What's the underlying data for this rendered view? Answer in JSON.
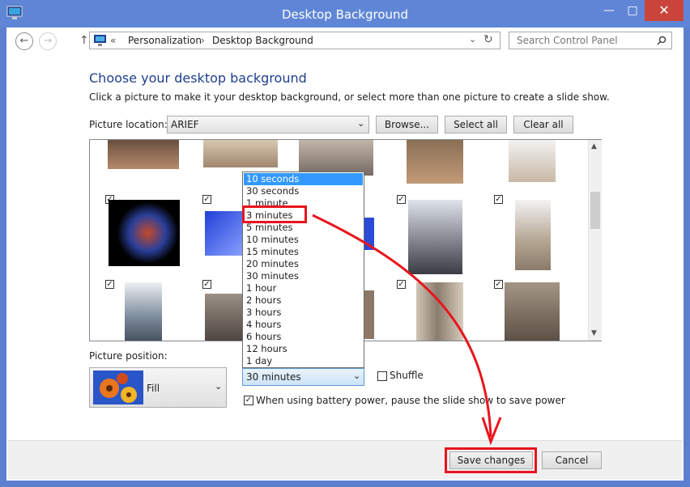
{
  "window": {
    "title": "Desktop Background",
    "minimize_icon": "minimize-icon",
    "maximize_icon": "maximize-icon",
    "close_icon": "close-icon"
  },
  "nav": {
    "back_icon": "back-arrow-icon",
    "forward_icon": "forward-arrow-icon",
    "up_icon": "up-arrow-icon",
    "breadcrumb_sep": "«",
    "breadcrumb": [
      "Personalization",
      "Desktop Background"
    ],
    "search_placeholder": "Search Control Panel"
  },
  "main": {
    "heading": "Choose your desktop background",
    "subtext": "Click a picture to make it your desktop background, or select more than one picture to create a slide show.",
    "picture_location_label": "Picture location:",
    "picture_location_value": "ARIEF",
    "browse_label": "Browse...",
    "select_all_label": "Select all",
    "clear_all_label": "Clear all"
  },
  "slideshow": {
    "interval_options": [
      "10 seconds",
      "30 seconds",
      "1 minute",
      "3 minutes",
      "5 minutes",
      "10 minutes",
      "15 minutes",
      "20 minutes",
      "30 minutes",
      "1 hour",
      "2 hours",
      "3 hours",
      "4 hours",
      "6 hours",
      "12 hours",
      "1 day"
    ],
    "highlighted_option": "10 seconds",
    "annotated_option": "3 minutes",
    "interval_value": "30 minutes",
    "shuffle_label": "Shuffle",
    "shuffle_checked": false,
    "battery_label": "When using battery power, pause the slide show to save power",
    "battery_checked": true
  },
  "position": {
    "label": "Picture position:",
    "value": "Fill"
  },
  "footer": {
    "save_label": "Save changes",
    "cancel_label": "Cancel"
  },
  "colors": {
    "title_bar": "#5f86d6",
    "heading": "#1e3f8f",
    "annotation_red": "#e8141d",
    "selection": "#3399ff"
  }
}
